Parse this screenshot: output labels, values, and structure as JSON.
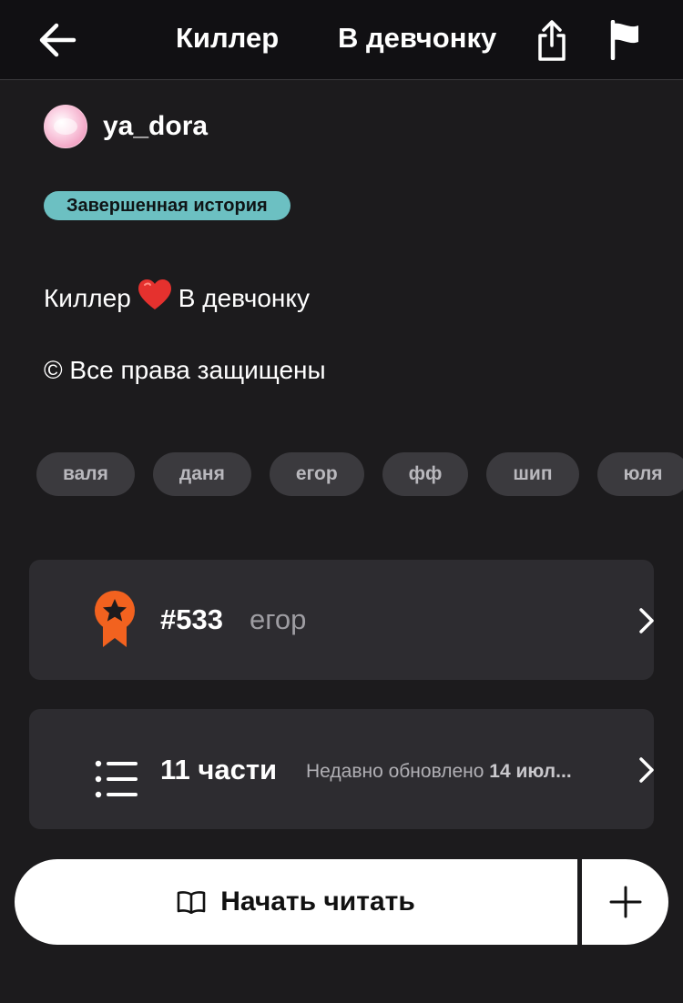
{
  "header": {
    "title_part1": "Киллер",
    "title_part2": "В девчонку",
    "back_icon": "arrow-left-icon",
    "share_icon": "share-icon",
    "flag_icon": "flag-icon"
  },
  "author": {
    "name": "ya_dora"
  },
  "status": {
    "label": "Завершенная история",
    "color": "#6cc0c2"
  },
  "description": {
    "line1_before": "Киллер",
    "line1_emoji": "heart-icon",
    "line1_after": "В девчонку",
    "line2": "© Все права защищены"
  },
  "tags": [
    "валя",
    "даня",
    "егор",
    "фф",
    "шип",
    "юля"
  ],
  "ranking": {
    "rank": "#533",
    "tag": "егор",
    "accent_color": "#f2621f"
  },
  "parts": {
    "count_label": "11 части",
    "updated_prefix": "Недавно обновлено",
    "updated_date": "14 июл..."
  },
  "actions": {
    "read_label": "Начать читать"
  },
  "colors": {
    "background": "#1c1b1d",
    "card": "#2d2c30",
    "tag": "#3b3a3e"
  }
}
